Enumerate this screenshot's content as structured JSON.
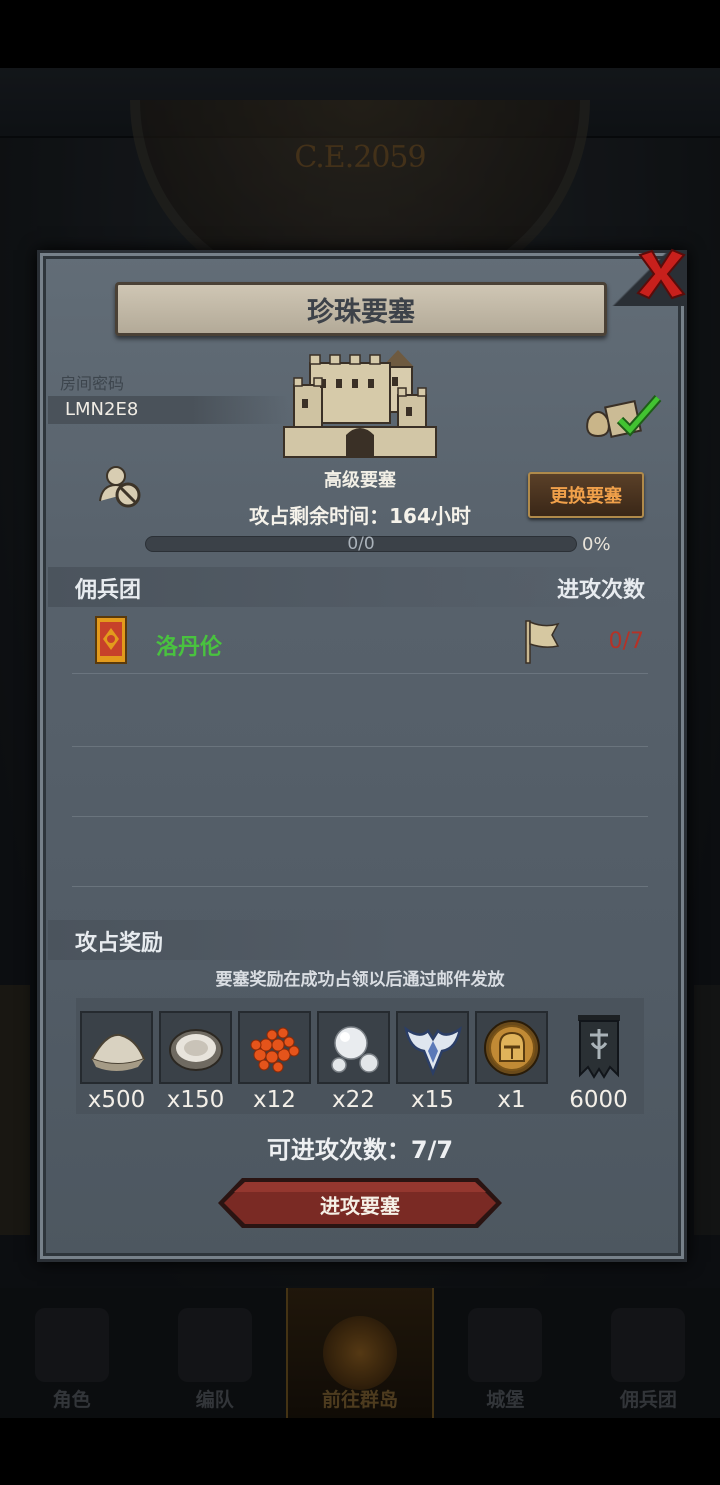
{
  "background": {
    "era_label": "C.E.2059"
  },
  "nav": {
    "items": [
      {
        "label": "角色",
        "icon": "knight-helmet-icon"
      },
      {
        "label": "编队",
        "icon": "soldier-icon"
      },
      {
        "label": "前往群岛",
        "icon": "globe-compass-icon",
        "active": true
      },
      {
        "label": "城堡",
        "icon": "castle-icon"
      },
      {
        "label": "佣兵团",
        "icon": "mercenary-icon"
      }
    ]
  },
  "panel": {
    "title": "珍珠要塞",
    "room_label": "房间密码",
    "room_code": "LMN2E8",
    "fortress_type": "高级要塞",
    "time_label": "攻占剩余时间：",
    "time_value": "164小时",
    "change_button": "更换要塞",
    "progress": {
      "text": "0/0",
      "percent_text": "0%",
      "fraction": 0
    },
    "mercenary_header": "佣兵团",
    "attack_count_header": "进攻次数",
    "guilds": [
      {
        "name": "洛丹伦",
        "attacks": "0/7"
      }
    ],
    "rewards_header": "攻占奖励",
    "rewards_note": "要塞奖励在成功占领以后通过邮件发放",
    "rewards": [
      {
        "icon": "rice-pile-icon",
        "qty": "x500"
      },
      {
        "icon": "oyster-icon",
        "qty": "x150"
      },
      {
        "icon": "fish-roe-icon",
        "qty": "x12"
      },
      {
        "icon": "pearl-icon",
        "qty": "x22"
      },
      {
        "icon": "winged-emblem-icon",
        "qty": "x15"
      },
      {
        "icon": "knight-medal-icon",
        "qty": "x1"
      },
      {
        "icon": "guild-banner-icon",
        "qty": "6000"
      }
    ],
    "attempts_text": "可进攻次数：7/7",
    "attack_button": "进攻要塞"
  },
  "colors": {
    "panel": "#58626c",
    "guild_name": "#49c23f",
    "attack_count": "#b53227",
    "change_button_text": "#f0a04a",
    "attack_button": "#7a2a24"
  }
}
